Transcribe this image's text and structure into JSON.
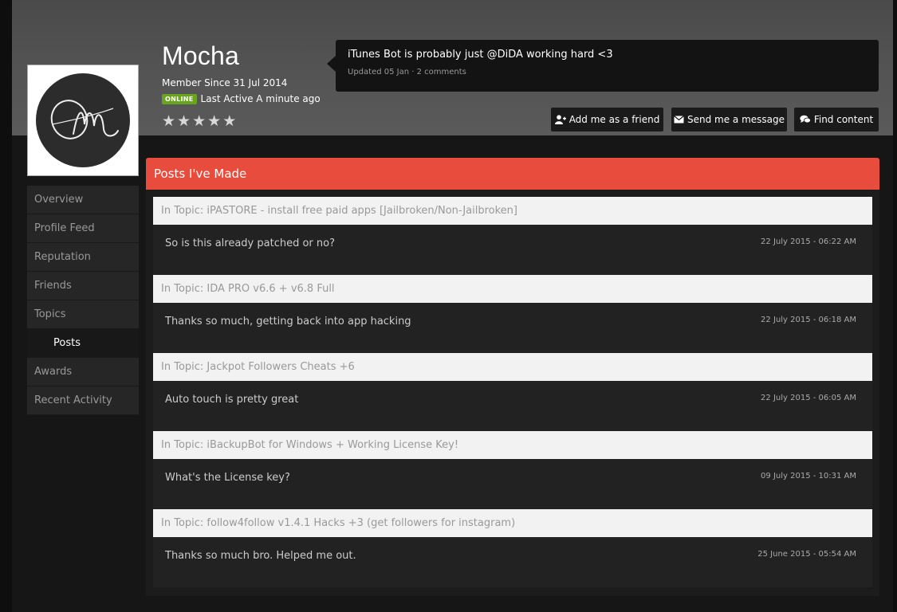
{
  "profile": {
    "username": "Mocha",
    "member_since": "Member Since 31 Jul 2014",
    "online_badge": "ONLINE",
    "last_active": "Last Active A minute ago",
    "rating_stars": 0,
    "avatar_monogram": "OM"
  },
  "status": {
    "text": "iTunes Bot is probably just @DiDA working hard <3",
    "meta": "Updated 05 Jan · 2 comments"
  },
  "actions": {
    "add_friend": "Add me as a friend",
    "send_message": "Send me a message",
    "find_content": "Find content"
  },
  "sidebar": {
    "items": [
      {
        "label": "Overview",
        "active": false
      },
      {
        "label": "Profile Feed",
        "active": false
      },
      {
        "label": "Reputation",
        "active": false
      },
      {
        "label": "Friends",
        "active": false
      },
      {
        "label": "Topics",
        "active": false
      },
      {
        "label": "Posts",
        "active": true
      },
      {
        "label": "Awards",
        "active": false
      },
      {
        "label": "Recent Activity",
        "active": false
      }
    ]
  },
  "posts_section": {
    "title": "Posts I've Made",
    "posts": [
      {
        "topic": "In Topic: iPASTORE - install free paid apps [Jailbroken/Non-Jailbroken]",
        "text": "So is this already patched or no?",
        "date": "22 July 2015 - 06:22 AM"
      },
      {
        "topic": "In Topic: IDA PRO v6.6 + v6.8 Full",
        "text": "Thanks so much, getting back into app hacking",
        "date": "22 July 2015 - 06:18 AM"
      },
      {
        "topic": "In Topic: Jackpot Followers Cheats +6",
        "text": "Auto touch is pretty great",
        "date": "22 July 2015 - 06:05 AM"
      },
      {
        "topic": "In Topic: iBackupBot for Windows + Working License Key!",
        "text": "What's the License key?",
        "date": "09 July 2015 - 10:31 AM"
      },
      {
        "topic": "In Topic: follow4follow v1.4.1 Hacks +3 (get followers for instagram)",
        "text": "Thanks so much bro. Helped me out.",
        "date": "25 June 2015 - 05:54 AM"
      }
    ]
  },
  "colors": {
    "accent": "#e74c3c",
    "online": "#6aa41f"
  }
}
